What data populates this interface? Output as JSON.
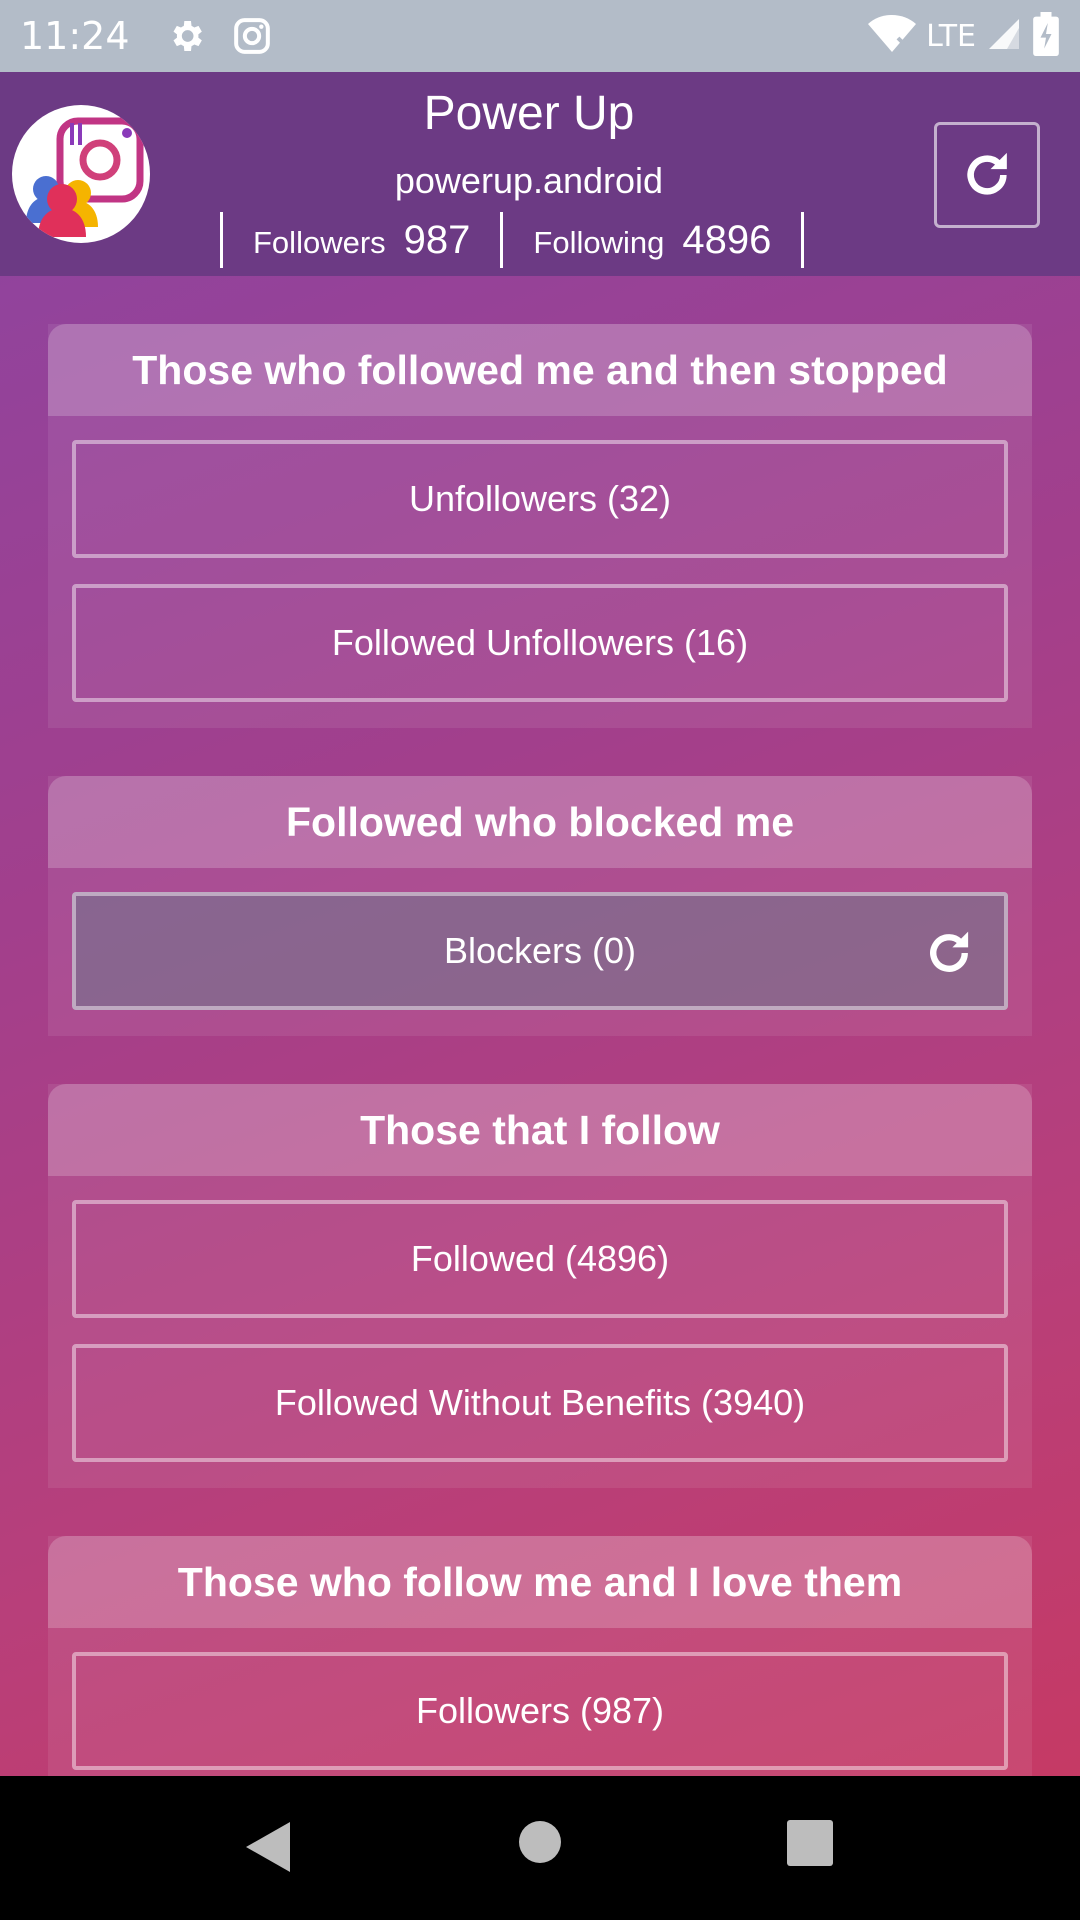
{
  "status_bar": {
    "time": "11:24",
    "icons": [
      "gear-icon",
      "instagram-icon",
      "wifi-icon",
      "signal-icon",
      "battery-icon"
    ],
    "network": "LTE"
  },
  "header": {
    "title": "Power Up",
    "username": "powerup.android",
    "followers_label": "Followers",
    "followers_count": "987",
    "following_label": "Following",
    "following_count": "4896"
  },
  "sections": [
    {
      "title": "Those who followed me and then stopped",
      "buttons": [
        {
          "label": "Unfollowers (32)"
        },
        {
          "label": "Followed Unfollowers (16)"
        }
      ]
    },
    {
      "title": "Followed who blocked me",
      "buttons": [
        {
          "label": "Blockers (0)"
        }
      ]
    },
    {
      "title": "Those that I follow",
      "buttons": [
        {
          "label": "Followed (4896)"
        },
        {
          "label": "Followed Without Benefits (3940)"
        }
      ]
    },
    {
      "title": "Those who follow me and I love them",
      "buttons": [
        {
          "label": "Followers (987)"
        }
      ]
    }
  ],
  "colors": {
    "header_bg": "#6c3a84",
    "status_bar_bg": "#b3bcc8",
    "gradient_start": "#8a45a3",
    "gradient_end": "#c9385f"
  }
}
